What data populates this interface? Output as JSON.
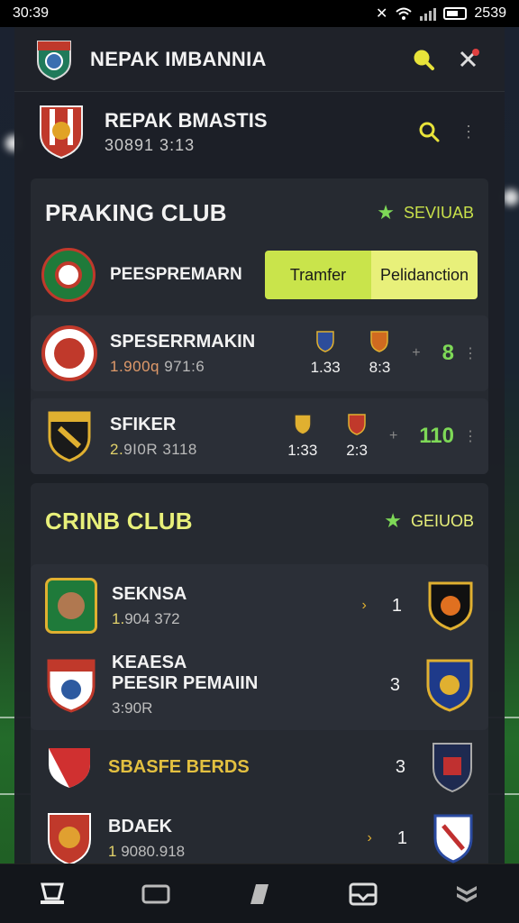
{
  "status_bar": {
    "time": "30:39",
    "battery_text": "2539"
  },
  "header": {
    "title": "NEPAK IMBANNIA"
  },
  "profile": {
    "name": "REPAK BMASTIS",
    "sub": "30891 3:13"
  },
  "section1": {
    "title": "PRAKING CLUB",
    "link": "SEVIUAB",
    "top_row": {
      "name": "PEESPREMARN",
      "seg_a": "Tramfer",
      "seg_b": "Pelidanction"
    },
    "cards": [
      {
        "name": "SPESERRMAKIN",
        "meta_hl": "1.900q",
        "meta_rest": " 971:6",
        "stat1": "1.33",
        "stat2": "8:3",
        "score": "8"
      },
      {
        "name": "SFIKER",
        "meta_hl": "2.",
        "meta_rest": "9I0R 3118",
        "stat1": "1:33",
        "stat2": "2:3",
        "score": "110"
      }
    ]
  },
  "section2": {
    "title": "CRINB CLUB",
    "link": "GEIUOB",
    "rows": [
      {
        "name": "SEKNSA",
        "meta_hl": "1.",
        "meta_rest": "904 372",
        "count": "1"
      },
      {
        "name": "KEAESA",
        "name2": "PEESIR PEMAIIN",
        "meta_hl": "",
        "meta_rest": "3:90R",
        "count": "3"
      },
      {
        "name": "SBASFE BERDS",
        "meta_hl": "",
        "meta_rest": "",
        "count": "3"
      },
      {
        "name": "BDAEK",
        "meta_hl": "1",
        "meta_rest": " 9080.918",
        "count": "1"
      }
    ]
  },
  "colors": {
    "accent": "#c9e44b",
    "accent_light": "#e8f07a",
    "panel": "#262a31",
    "card": "#2b2f37"
  }
}
